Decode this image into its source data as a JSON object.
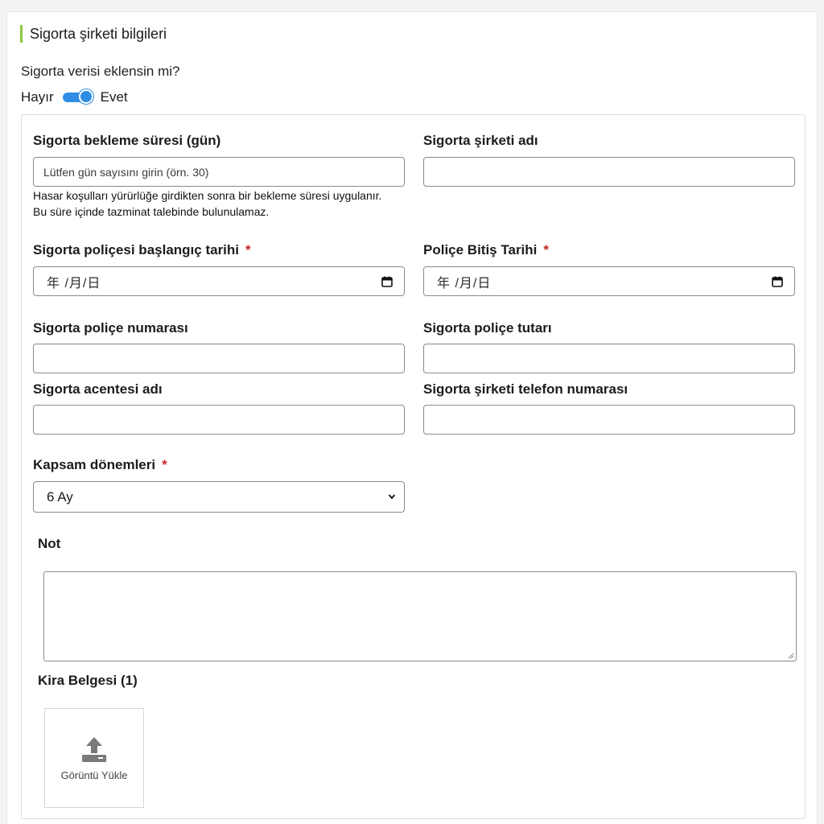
{
  "section": {
    "title": "Sigorta şirketi bilgileri"
  },
  "insurance_toggle": {
    "question": "Sigorta verisi eklensin mi?",
    "off_label": "Hayır",
    "on_label": "Evet",
    "state": "on"
  },
  "form": {
    "waiting_period": {
      "label": "Sigorta bekleme süresi (gün)",
      "placeholder": "Lütfen gün sayısını girin (örn. 30)",
      "hint_line1": "Hasar koşulları yürürlüğe girdikten sonra bir bekleme süresi uygulanır.",
      "hint_line2": "Bu süre içinde tazminat talebinde bulunulamaz."
    },
    "company_name": {
      "label": "Sigorta şirketi adı",
      "value": ""
    },
    "start_date": {
      "label": "Sigorta poliçesi başlangıç tarihi",
      "required": "*",
      "placeholder": "年 /月/日"
    },
    "end_date": {
      "label": "Poliçe Bitiş Tarihi",
      "required": "*",
      "placeholder": "年 /月/日"
    },
    "policy_number": {
      "label": "Sigorta poliçe numarası",
      "value": ""
    },
    "policy_amount": {
      "label": "Sigorta poliçe tutarı",
      "value": ""
    },
    "agent_name": {
      "label": "Sigorta acentesi adı",
      "value": ""
    },
    "company_phone": {
      "label": "Sigorta şirketi telefon numarası",
      "value": ""
    },
    "coverage_period": {
      "label": "Kapsam dönemleri",
      "required": "*",
      "selected": "6 Ay"
    },
    "note": {
      "label": "Not",
      "value": ""
    },
    "rental_document": {
      "label": "Kira Belgesi (1)",
      "upload_label": "Görüntü Yükle"
    }
  },
  "colors": {
    "accent_green": "#8cc63f",
    "toggle_blue": "#2f8de4",
    "required_red": "#c62828"
  },
  "icons": [
    "calendar-icon",
    "chevron-down-icon",
    "upload-icon",
    "resize-handle-icon"
  ]
}
